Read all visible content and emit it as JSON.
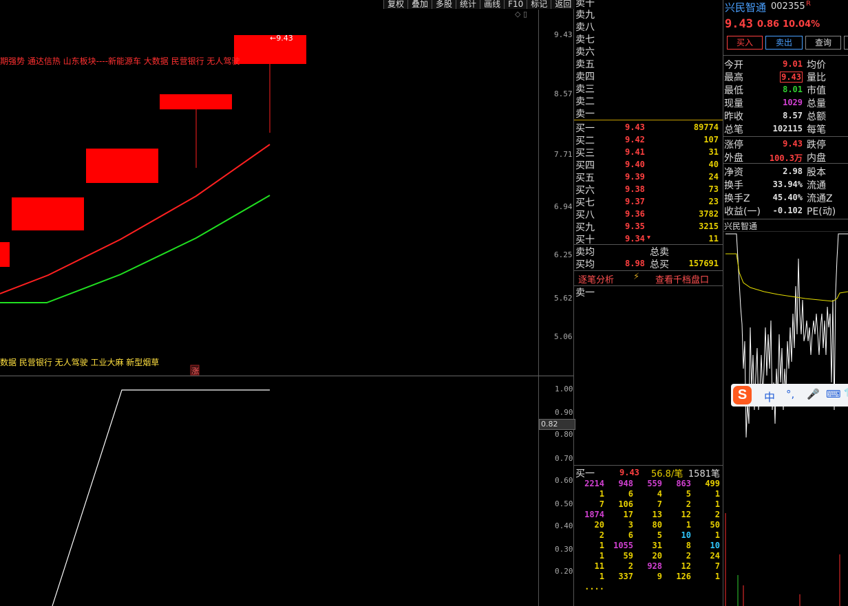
{
  "toolbar": [
    "复权",
    "叠加",
    "多股",
    "统计",
    "画线",
    "F10",
    "标记",
    "返回"
  ],
  "corner_icons": "◇ ▯",
  "price_axis": [
    "9.43",
    "8.57",
    "7.71",
    "6.94",
    "6.25",
    "5.62",
    "5.06"
  ],
  "candle_label": "←9.43",
  "news_top": "期强势 通达信热 山东板块----新能源车 大数据 民营银行 无人驾驶",
  "news_bottom": "数据 民营银行 无人驾驶 工业大麻 新型烟草",
  "up_marker": "涨",
  "indicator_axis": [
    "1.00",
    "0.90",
    "0.80",
    "0.70",
    "0.60",
    "0.50",
    "0.40",
    "0.30",
    "0.20"
  ],
  "indicator_current": "0.82",
  "sell_labels": [
    "卖十",
    "卖九",
    "卖八",
    "卖七",
    "卖六",
    "卖五",
    "卖四",
    "卖三",
    "卖二",
    "卖一"
  ],
  "buys": [
    {
      "label": "买一",
      "price": "9.43",
      "vol": "89774"
    },
    {
      "label": "买二",
      "price": "9.42",
      "vol": "107"
    },
    {
      "label": "买三",
      "price": "9.41",
      "vol": "31"
    },
    {
      "label": "买四",
      "price": "9.40",
      "vol": "40"
    },
    {
      "label": "买五",
      "price": "9.39",
      "vol": "24"
    },
    {
      "label": "买六",
      "price": "9.38",
      "vol": "73"
    },
    {
      "label": "买七",
      "price": "9.37",
      "vol": "23"
    },
    {
      "label": "买八",
      "price": "9.36",
      "vol": "3782"
    },
    {
      "label": "买九",
      "price": "9.35",
      "vol": "3215"
    },
    {
      "label": "买十",
      "price": "9.34",
      "vol": "11"
    }
  ],
  "buy10_mark": "▾",
  "summary": {
    "sell_avg_label": "卖均",
    "sell_total_label": "总卖",
    "buy_avg_label": "买均",
    "buy_avg": "8.98",
    "buy_total_label": "总买",
    "buy_total": "157691"
  },
  "tabs": {
    "analysis": "逐笔分析",
    "bolt": "⚡",
    "thousand": "查看千档盘口"
  },
  "queue_label": "卖一",
  "ticks_header": {
    "label": "买一",
    "price": "9.43",
    "avg": "56.8/笔",
    "count": "1581笔"
  },
  "ticks": [
    [
      "2214",
      "948",
      "559",
      "863",
      "499"
    ],
    [
      "1",
      "6",
      "4",
      "5",
      "1"
    ],
    [
      "7",
      "106",
      "7",
      "2",
      "1"
    ],
    [
      "1874",
      "17",
      "13",
      "12",
      "2"
    ],
    [
      "20",
      "3",
      "80",
      "1",
      "50"
    ],
    [
      "2",
      "6",
      "5",
      "10",
      "1"
    ],
    [
      "1",
      "1055",
      "31",
      "8",
      "10"
    ],
    [
      "1",
      "59",
      "20",
      "2",
      "24"
    ],
    [
      "11",
      "2",
      "928",
      "12",
      "7"
    ],
    [
      "1",
      "337",
      "9",
      "126",
      "1"
    ],
    [
      "....",
      "",
      "",
      "",
      ""
    ]
  ],
  "tick_colors": [
    [
      "m",
      "m",
      "m",
      "m",
      "y"
    ],
    [
      "y",
      "y",
      "y",
      "y",
      "y"
    ],
    [
      "y",
      "y",
      "y",
      "y",
      "y"
    ],
    [
      "m",
      "y",
      "y",
      "y",
      "y"
    ],
    [
      "y",
      "y",
      "y",
      "y",
      "y"
    ],
    [
      "y",
      "y",
      "y",
      "c",
      "y"
    ],
    [
      "y",
      "m",
      "y",
      "y",
      "c"
    ],
    [
      "y",
      "y",
      "y",
      "y",
      "y"
    ],
    [
      "y",
      "y",
      "m",
      "y",
      "y"
    ],
    [
      "y",
      "y",
      "y",
      "y",
      "y"
    ],
    [
      "y",
      "y",
      "y",
      "y",
      "y"
    ]
  ],
  "stock": {
    "name": "兴民智通",
    "code": "002355",
    "badge": "R",
    "price": "9.43",
    "change": "0.86",
    "pct": "10.04%"
  },
  "buttons": {
    "buy": "买入",
    "sell": "卖出",
    "query": "查询"
  },
  "stats": [
    {
      "k": "今开",
      "v": "9.01",
      "c": "#ff4040",
      "k2": "均价"
    },
    {
      "k": "最高",
      "v": "9.43",
      "c": "#ff4040",
      "k2": "量比",
      "box": true
    },
    {
      "k": "最低",
      "v": "8.01",
      "c": "#30d030",
      "k2": "市值"
    },
    {
      "k": "现量",
      "v": "1029",
      "c": "#d040d0",
      "k2": "总量"
    },
    {
      "k": "昨收",
      "v": "8.57",
      "c": "#e0e0e0",
      "k2": "总额"
    },
    {
      "k": "总笔",
      "v": "102115",
      "c": "#e0e0e0",
      "k2": "每笔"
    },
    {
      "k": "涨停",
      "v": "9.43",
      "c": "#ff4040",
      "k2": "跌停"
    },
    {
      "k": "外盘",
      "v": "100.3万",
      "c": "#ff4040",
      "k2": "内盘"
    },
    {
      "k": "净资",
      "v": "2.98",
      "c": "#e0e0e0",
      "k2": "股本"
    },
    {
      "k": "换手",
      "v": "33.94%",
      "c": "#e0e0e0",
      "k2": "流通"
    },
    {
      "k": "换手Z",
      "v": "45.40%",
      "c": "#e0e0e0",
      "k2": "流通Z"
    },
    {
      "k": "收益(一)",
      "v": "-0.102",
      "c": "#e0e0e0",
      "k2": "PE(动)"
    }
  ],
  "mini_chart_title": "兴民智通",
  "ime": {
    "lang": "中",
    "punct": "°,",
    "mic": "🎤",
    "keyboard": "⌨",
    "menu": "👕"
  }
}
